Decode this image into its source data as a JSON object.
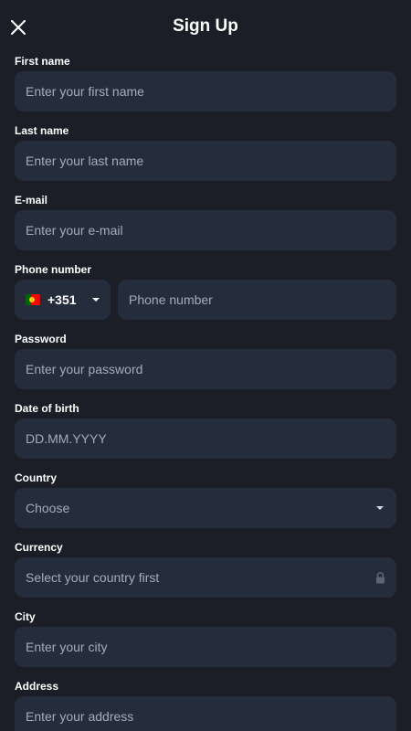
{
  "header": {
    "title": "Sign Up",
    "close_icon": "close-icon"
  },
  "form": {
    "first_name": {
      "label": "First name",
      "placeholder": "Enter your first name"
    },
    "last_name": {
      "label": "Last name",
      "placeholder": "Enter your last name"
    },
    "email": {
      "label": "E-mail",
      "placeholder": "Enter your e-mail"
    },
    "phone": {
      "label": "Phone number",
      "country_code": "+351",
      "flag_icon": "portugal-flag-icon",
      "placeholder": "Phone number"
    },
    "password": {
      "label": "Password",
      "placeholder": "Enter your password"
    },
    "date_of_birth": {
      "label": "Date of birth",
      "placeholder": "DD.MM.YYYY"
    },
    "country": {
      "label": "Country",
      "selected": "Choose"
    },
    "currency": {
      "label": "Currency",
      "placeholder": "Select your country first",
      "icon": "lock-icon"
    },
    "city": {
      "label": "City",
      "placeholder": "Enter your city"
    },
    "address": {
      "label": "Address",
      "placeholder": "Enter your address"
    }
  },
  "colors": {
    "background": "#1b1e27",
    "field_background": "#252c3b",
    "placeholder_text": "#a4adbd",
    "label_text": "#ffffff"
  }
}
